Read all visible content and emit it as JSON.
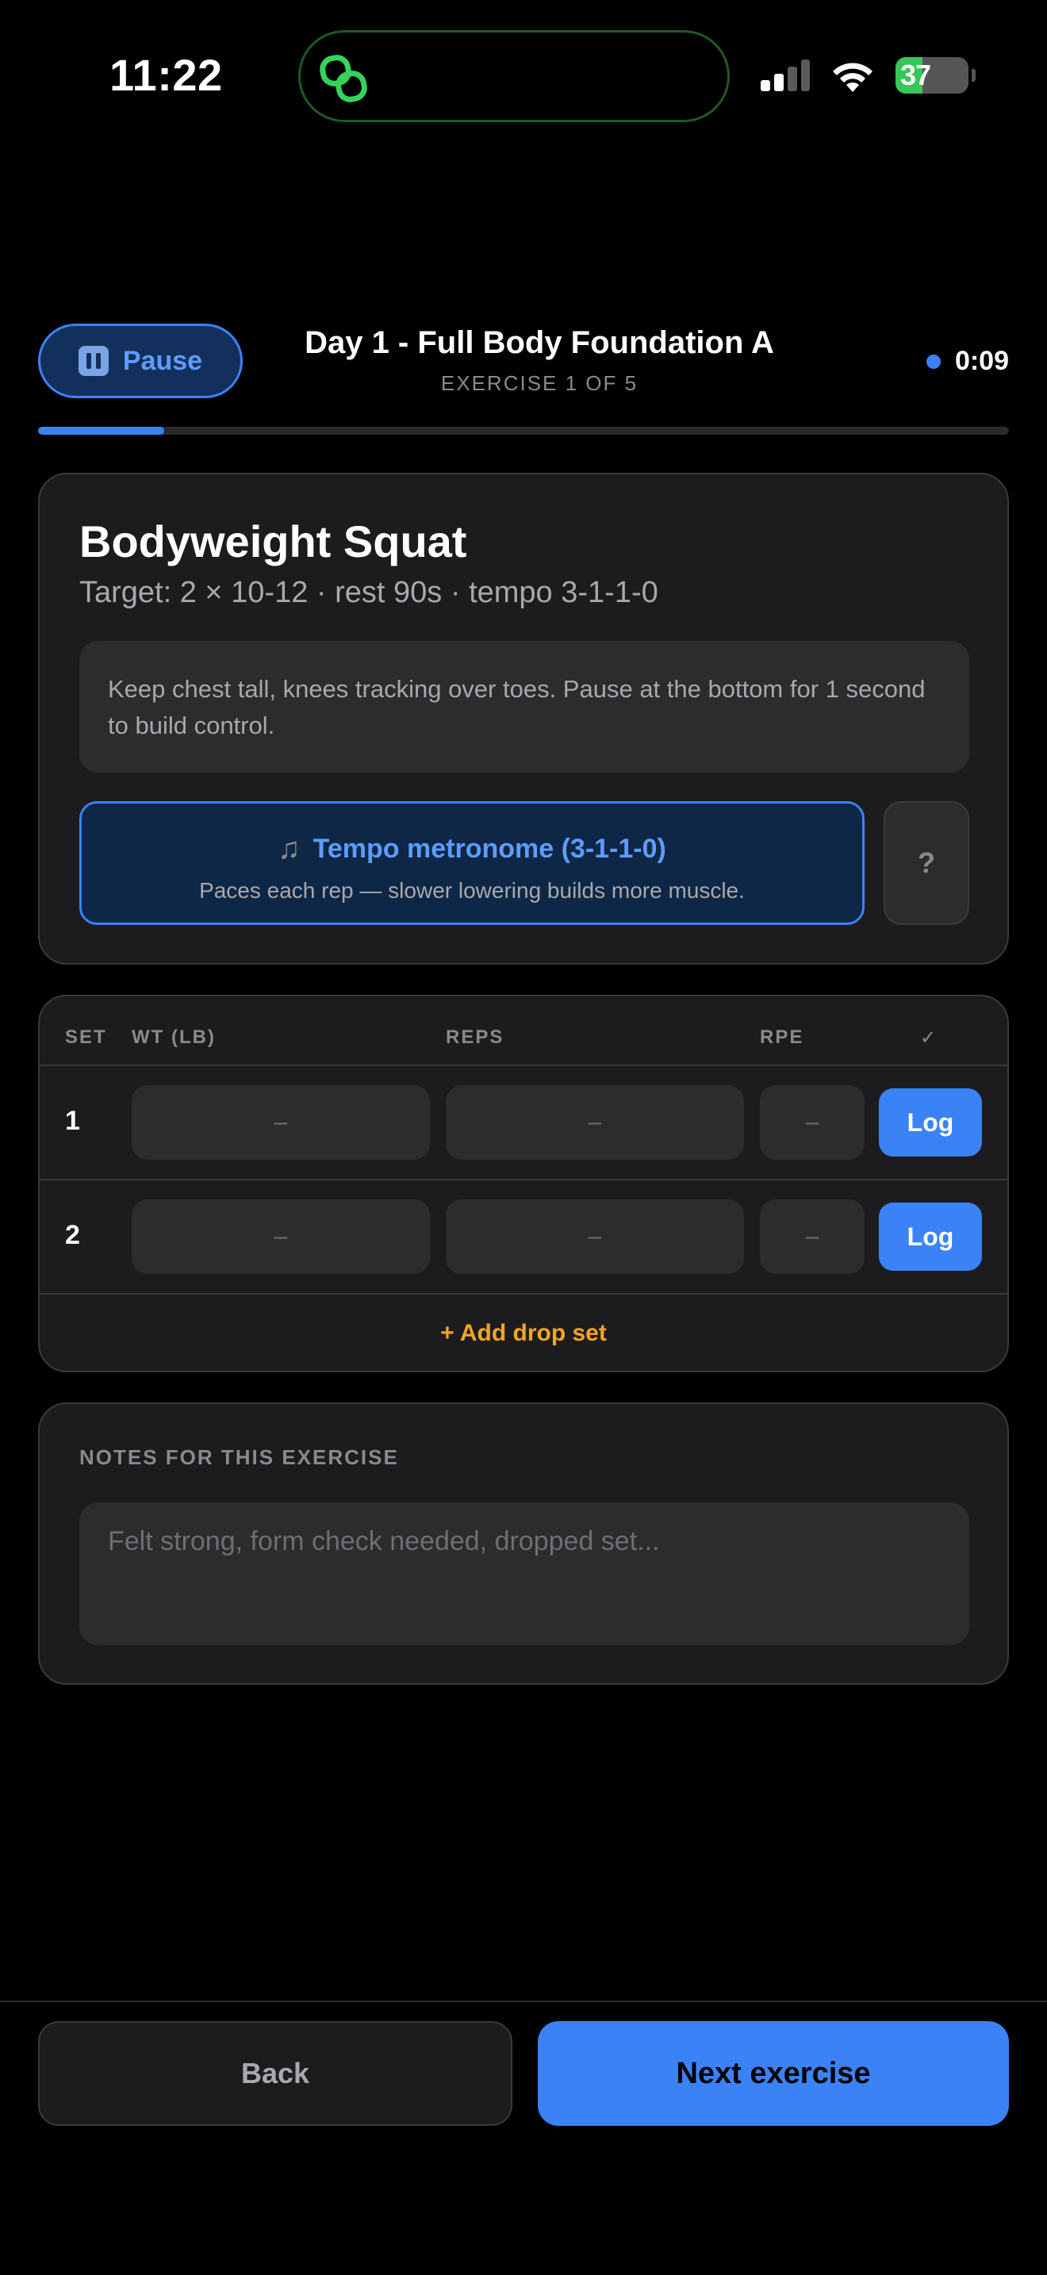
{
  "status_bar": {
    "time": "11:22",
    "battery": "37",
    "icons": [
      "link-icon",
      "cellular-signal-icon",
      "wifi-icon",
      "battery-charging-icon"
    ]
  },
  "header": {
    "pause_label": "Pause",
    "workout_title": "Day 1 - Full Body Foundation A",
    "exercise_count": "EXERCISE 1 OF 5",
    "timer": "0:09",
    "progress": 0.13
  },
  "exercise": {
    "name": "Bodyweight Squat",
    "target": "Target: 2 × 10-12 · rest 90s · tempo 3-1-1-0",
    "cue": "Keep chest tall, knees tracking over toes. Pause at the bottom for 1 second to build control.",
    "metronome_title": "Tempo metronome (3-1-1-0)",
    "metronome_subtitle": "Paces each rep — slower lowering builds more muscle.",
    "help_label": "?"
  },
  "sets": {
    "headers": {
      "set": "SET",
      "weight": "WT (LB)",
      "reps": "REPS",
      "rpe": "RPE",
      "done": "✓"
    },
    "rows": [
      {
        "num": "1",
        "weight": "–",
        "reps": "–",
        "rpe": "–",
        "log_label": "Log"
      },
      {
        "num": "2",
        "weight": "–",
        "reps": "–",
        "rpe": "–",
        "log_label": "Log"
      }
    ],
    "add_drop_label": "+ Add drop set"
  },
  "notes": {
    "label": "NOTES FOR THIS EXERCISE",
    "placeholder": "Felt strong, form check needed, dropped set..."
  },
  "footer": {
    "back_label": "Back",
    "next_label": "Next exercise"
  },
  "colors": {
    "accent": "#3b82f6",
    "drop_set": "#f5a524",
    "card": "#1c1c1e",
    "battery_fill": "#35c759"
  }
}
